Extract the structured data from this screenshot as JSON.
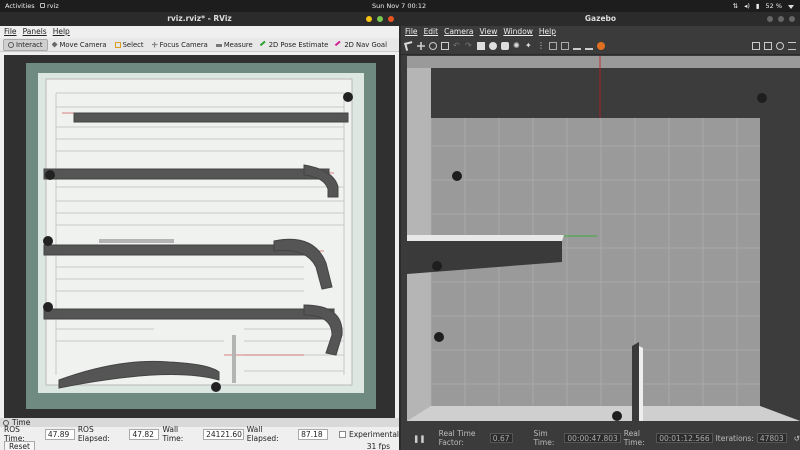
{
  "topbar": {
    "activities": "Activities",
    "app": "rviz",
    "clock": "Sun Nov 7  00:12",
    "battery": "52 %"
  },
  "rviz": {
    "title": "rviz.rviz* - RViz",
    "menu": [
      "File",
      "Panels",
      "Help"
    ],
    "tools": [
      {
        "label": "Interact",
        "icon": "interact-icon"
      },
      {
        "label": "Move Camera",
        "icon": "move-camera-icon"
      },
      {
        "label": "Select",
        "icon": "select-icon"
      },
      {
        "label": "Focus Camera",
        "icon": "focus-camera-icon"
      },
      {
        "label": "Measure",
        "icon": "measure-icon"
      },
      {
        "label": "2D Pose Estimate",
        "icon": "pose-estimate-icon"
      },
      {
        "label": "2D Nav Goal",
        "icon": "nav-goal-icon"
      }
    ],
    "time_panel": {
      "title": "Time",
      "ros_time_label": "ROS Time:",
      "ros_time": "47.89",
      "ros_elapsed_label": "ROS Elapsed:",
      "ros_elapsed": "47.82",
      "wall_time_label": "Wall Time:",
      "wall_time": "24121.60",
      "wall_elapsed_label": "Wall Elapsed:",
      "wall_elapsed": "87.18",
      "experimental_label": "Experimental",
      "reset_label": "Reset",
      "fps": "31 fps"
    }
  },
  "gazebo": {
    "title": "Gazebo",
    "menu": [
      "File",
      "Edit",
      "Camera",
      "View",
      "Window",
      "Help"
    ],
    "status": {
      "rtf_label": "Real Time Factor:",
      "rtf": "0.67",
      "sim_label": "Sim Time:",
      "sim": "00:00:47.803",
      "real_label": "Real Time:",
      "real": "00:01:12.566",
      "iter_label": "Iterations:",
      "iter": "47803"
    }
  },
  "colors": {
    "close": "#e95420",
    "minimize": "#f5c211",
    "maximize": "#78c850"
  }
}
